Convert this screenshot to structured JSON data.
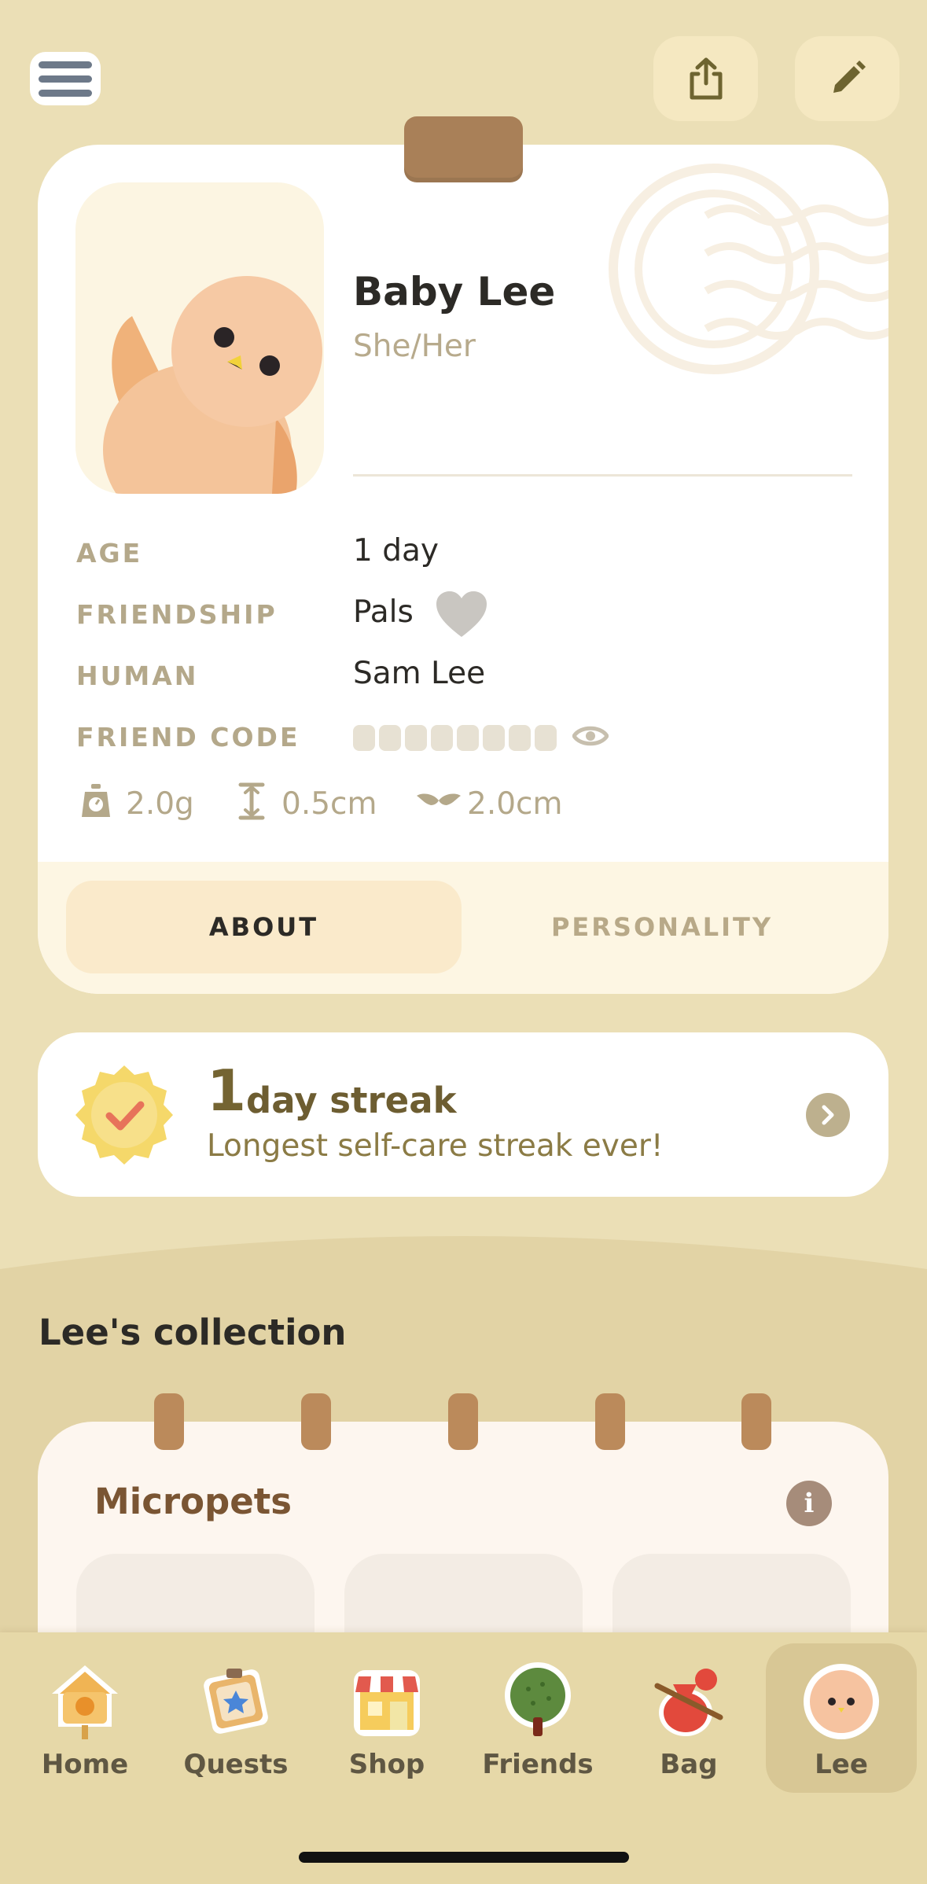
{
  "header": {
    "menu_icon": "hamburger-menu-icon",
    "share_icon": "share-icon",
    "edit_icon": "pencil-icon"
  },
  "profile": {
    "name": "Baby Lee",
    "pronouns": "She/Her",
    "rows": [
      {
        "label": "AGE",
        "value": "1 day"
      },
      {
        "label": "FRIENDSHIP",
        "value": "Pals"
      },
      {
        "label": "HUMAN",
        "value": "Sam Lee"
      },
      {
        "label": "FRIEND CODE",
        "value": ""
      }
    ],
    "stats": {
      "weight": "2.0g",
      "height": "0.5cm",
      "wingspan": "2.0cm"
    },
    "tabs": [
      {
        "label": "ABOUT",
        "active": true
      },
      {
        "label": "PERSONALITY",
        "active": false
      }
    ]
  },
  "streak": {
    "number": "1",
    "title": "day streak",
    "subtitle": "Longest self-care streak ever!"
  },
  "collection": {
    "title": "Lee's collection",
    "notebook_title": "Micropets",
    "info_label": "i"
  },
  "nav": {
    "items": [
      {
        "label": "Home",
        "icon": "birdhouse-icon"
      },
      {
        "label": "Quests",
        "icon": "quest-board-icon"
      },
      {
        "label": "Shop",
        "icon": "shop-icon"
      },
      {
        "label": "Friends",
        "icon": "tree-icon"
      },
      {
        "label": "Bag",
        "icon": "bag-icon"
      },
      {
        "label": "Lee",
        "icon": "bird-face-icon",
        "active": true
      }
    ]
  },
  "colors": {
    "background": "#ebdfb6",
    "card": "#ffffff",
    "accent_brown": "#a98058",
    "active_tab": "#faeacb",
    "nav_background": "#e6d8a8"
  }
}
